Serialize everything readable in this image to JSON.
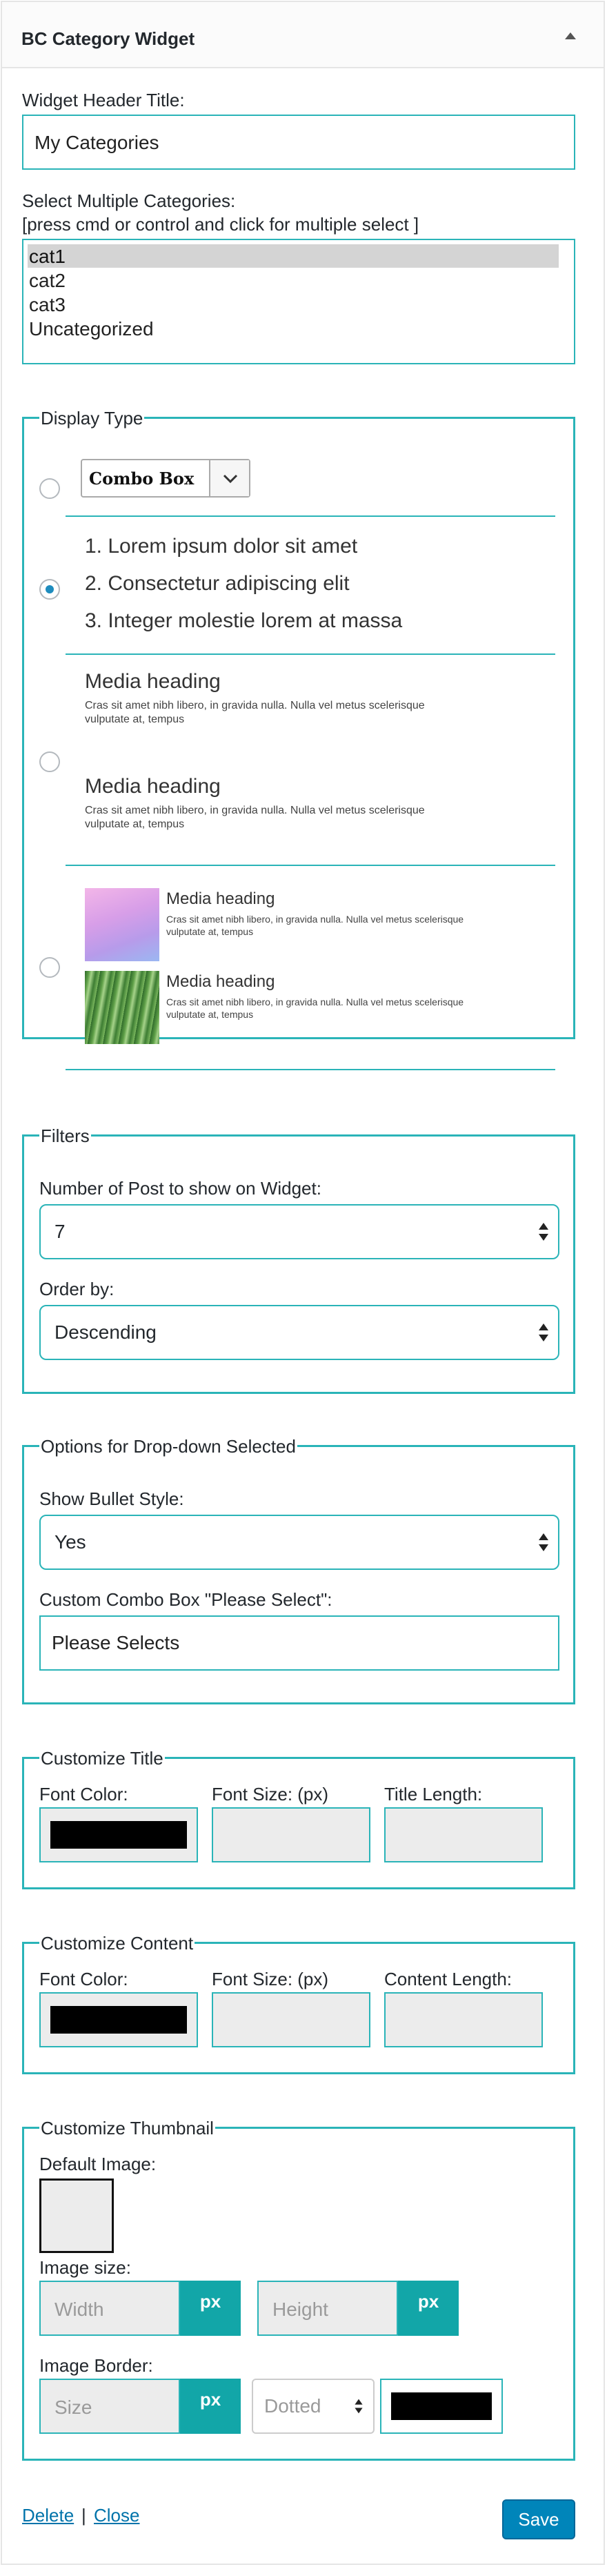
{
  "widget": {
    "title": "BC Category Widget"
  },
  "header_title": {
    "label": "Widget Header Title:",
    "value": "My Categories"
  },
  "categories": {
    "label": "Select Multiple Categories:",
    "hint": "[press cmd or control and click for multiple select ]",
    "options": [
      "cat1",
      "cat2",
      "cat3",
      "Uncategorized"
    ],
    "selected": "cat1"
  },
  "display_type": {
    "legend": "Display Type",
    "combo_label": "Combo Box",
    "list_items": [
      "1. Lorem ipsum dolor sit amet",
      "2. Consectetur adipiscing elit",
      "3. Integer molestie lorem at massa"
    ],
    "media_heading": "Media heading",
    "media_text_1": "Cras sit amet nibh libero, in gravida nulla. Nulla vel metus scelerisque",
    "media_text_2": "vulputate at, tempus",
    "thumb_text_1": "Cras sit amet nibh libero, in gravida nulla. Nulla vel metus scelerisque",
    "thumb_text_2": "vulputate at, tempus",
    "selected_option": 2
  },
  "filters": {
    "legend": "Filters",
    "posts_label": "Number of Post to show on Widget:",
    "posts_value": "7",
    "order_label": "Order by:",
    "order_value": "Descending"
  },
  "dropdown_options": {
    "legend": "Options for Drop-down Selected",
    "bullet_label": "Show Bullet Style:",
    "bullet_value": "Yes",
    "combo_label": "Custom Combo Box \"Please Select\":",
    "combo_value": "Please Selects"
  },
  "customize_title": {
    "legend": "Customize Title",
    "font_color": "Font Color:",
    "font_size": "Font Size: (px)",
    "length": "Title Length:",
    "color_value": "#000000"
  },
  "customize_content": {
    "legend": "Customize Content",
    "font_color": "Font Color:",
    "font_size": "Font Size: (px)",
    "length": "Content Length:",
    "color_value": "#000000"
  },
  "customize_thumbnail": {
    "legend": "Customize Thumbnail",
    "default_image": "Default Image:",
    "image_size": "Image size:",
    "width_placeholder": "Width",
    "height_placeholder": "Height",
    "px": "px",
    "image_border": "Image Border:",
    "size_placeholder": "Size",
    "border_style": "Dotted",
    "border_color": "#000000"
  },
  "footer": {
    "delete": "Delete",
    "separator": "|",
    "close": "Close",
    "save": "Save"
  },
  "colors": {
    "accent": "#2ab4b8",
    "button": "#0085ba",
    "px_button": "#12a6a8"
  }
}
